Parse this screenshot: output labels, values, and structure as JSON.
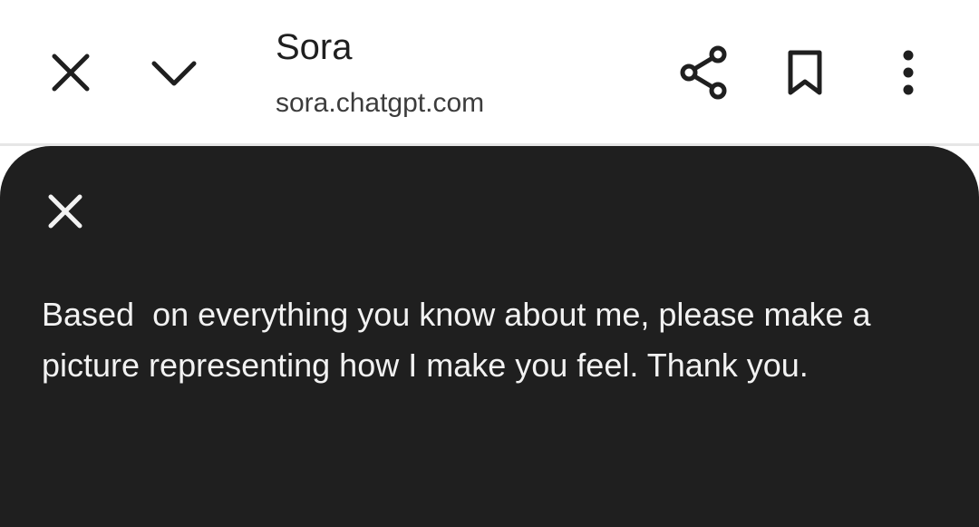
{
  "toolbar": {
    "close_icon": "close-icon",
    "minimize_icon": "chevron-down-icon",
    "share_icon": "share-icon",
    "bookmark_icon": "bookmark-icon",
    "more_icon": "more-vert-icon"
  },
  "page": {
    "title": "Sora",
    "url": "sora.chatgpt.com"
  },
  "sheet": {
    "close_icon": "close-icon",
    "prompt": "Based  on everything you know about me, please make a picture representing how I make you feel. Thank you."
  },
  "colors": {
    "toolbar_bg": "#ffffff",
    "sheet_bg": "#1f1f1f",
    "sheet_text": "#f2f2f2"
  }
}
